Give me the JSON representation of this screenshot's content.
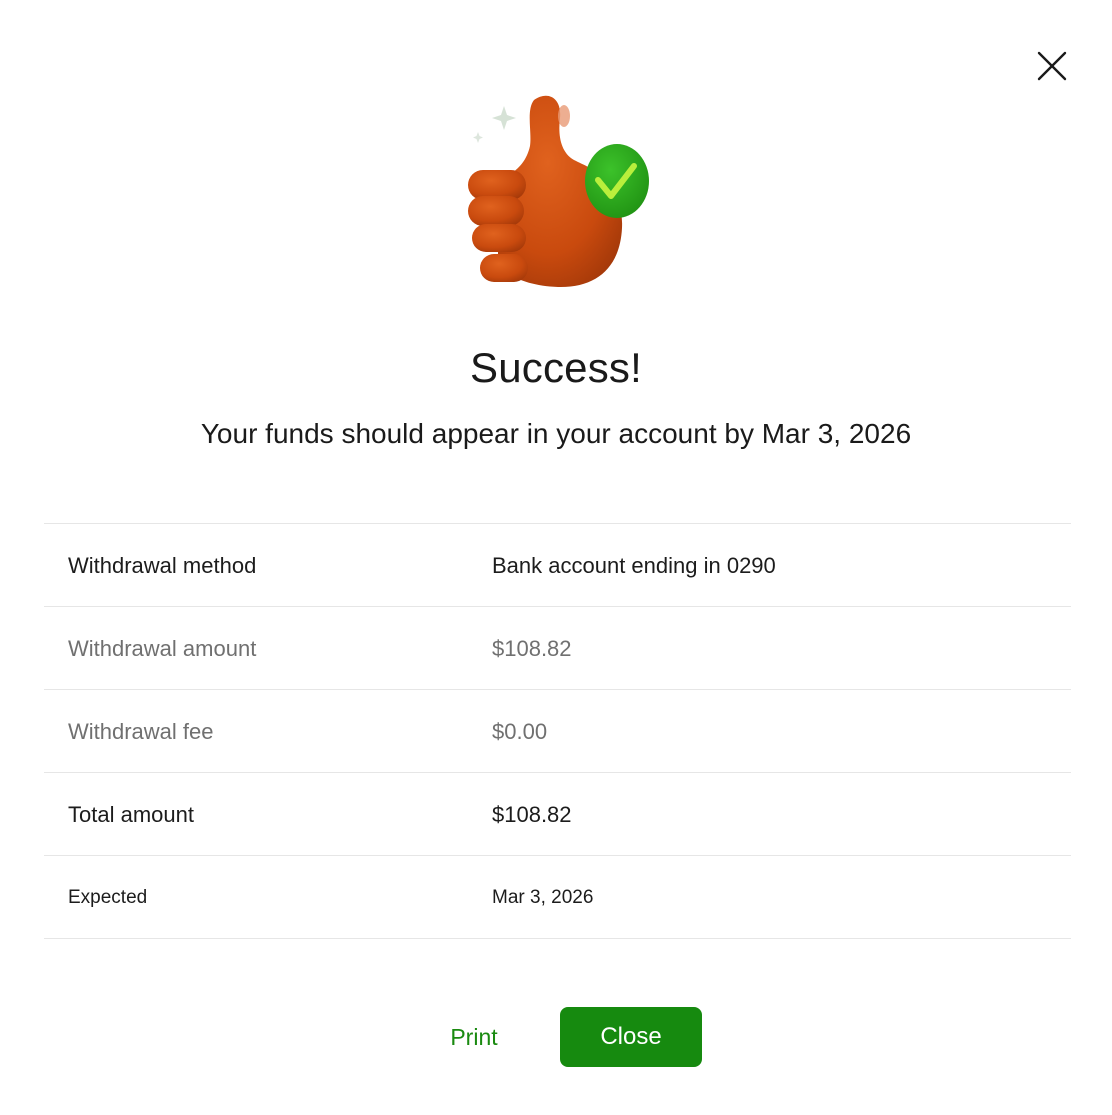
{
  "dialog": {
    "close_icon": "close-icon",
    "hero_icon": "thumbs-up-check-icon",
    "title": "Success!",
    "subtitle": "Your funds should appear in your account by Mar 3, 2026"
  },
  "details": [
    {
      "label": "Withdrawal method",
      "value": "Bank account ending in 0290"
    },
    {
      "label": "Withdrawal amount",
      "value": "$108.82"
    },
    {
      "label": "Withdrawal fee",
      "value": "$0.00"
    },
    {
      "label": "Total amount",
      "value": "$108.82"
    },
    {
      "label": "Expected",
      "value": "Mar 3, 2026"
    }
  ],
  "actions": {
    "print_label": "Print",
    "close_label": "Close"
  },
  "colors": {
    "accent_green": "#168a0f",
    "hand_orange": "#c94a0e",
    "check_green": "#2aa81a"
  }
}
